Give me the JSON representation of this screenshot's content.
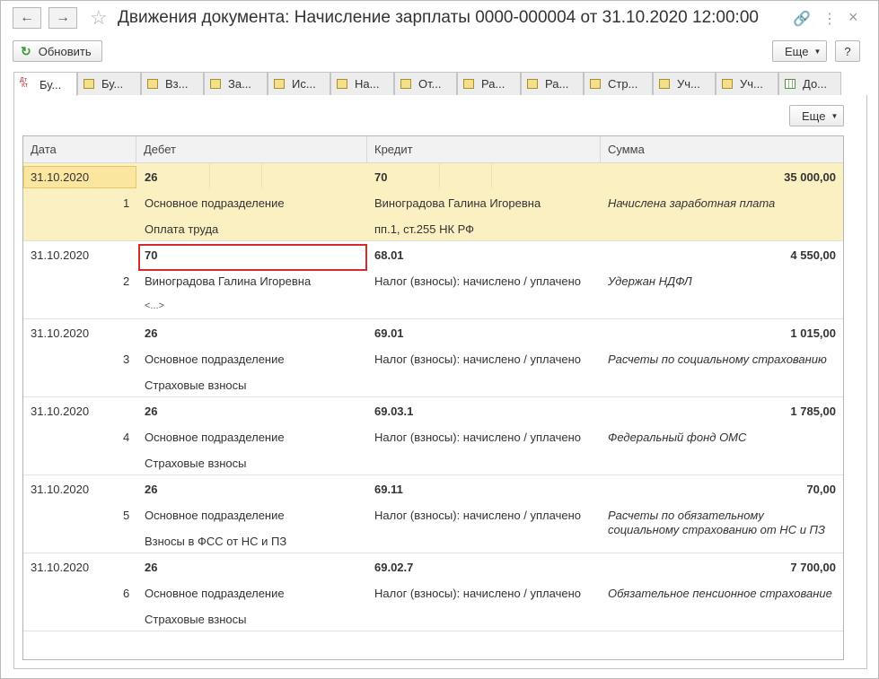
{
  "window": {
    "title": "Движения документа: Начисление зарплаты 0000-000004 от 31.10.2020 12:00:00",
    "back_icon": "←",
    "forward_icon": "→",
    "star_icon": "☆",
    "link_icon": "🔗",
    "more_icon": "⋮",
    "close_icon": "×"
  },
  "toolbar": {
    "refresh_label": "Обновить",
    "more_label": "Еще",
    "help_label": "?"
  },
  "tabs": [
    {
      "label": "Бу...",
      "icon": "dtkt-icon",
      "active": true
    },
    {
      "label": "Бу...",
      "icon": "register-icon"
    },
    {
      "label": "Вз...",
      "icon": "register-icon"
    },
    {
      "label": "За...",
      "icon": "register-icon"
    },
    {
      "label": "Ис...",
      "icon": "register-icon"
    },
    {
      "label": "На...",
      "icon": "register-icon"
    },
    {
      "label": "От...",
      "icon": "register-icon"
    },
    {
      "label": "Ра...",
      "icon": "register-icon"
    },
    {
      "label": "Ра...",
      "icon": "register-icon"
    },
    {
      "label": "Стр...",
      "icon": "register-icon"
    },
    {
      "label": "Уч...",
      "icon": "register-icon"
    },
    {
      "label": "Уч...",
      "icon": "register-icon"
    },
    {
      "label": "До...",
      "icon": "table-icon"
    }
  ],
  "panel": {
    "more_label": "Еще"
  },
  "table": {
    "columns": [
      "Дата",
      "Дебет",
      "Кредит",
      "Сумма"
    ],
    "rows": [
      {
        "date": "31.10.2020",
        "n": "1",
        "debit": "26",
        "debit_sub1": "Основное подразделение",
        "debit_sub2": "Оплата труда",
        "credit": "70",
        "credit_sub1": "Виноградова Галина Игоревна",
        "credit_sub2": "пп.1, ст.255 НК РФ",
        "amount": "35 000,00",
        "content": "Начислена заработная плата",
        "content2": ""
      },
      {
        "date": "31.10.2020",
        "n": "2",
        "debit": "70",
        "debit_sub1": "Виноградова Галина Игоревна",
        "debit_sub2": "<...>",
        "credit": "68.01",
        "credit_sub1": "Налог (взносы): начислено / уплачено",
        "credit_sub2": "",
        "amount": "4 550,00",
        "content": "Удержан НДФЛ",
        "content2": ""
      },
      {
        "date": "31.10.2020",
        "n": "3",
        "debit": "26",
        "debit_sub1": "Основное подразделение",
        "debit_sub2": "Страховые взносы",
        "credit": "69.01",
        "credit_sub1": "Налог (взносы): начислено / уплачено",
        "credit_sub2": "",
        "amount": "1 015,00",
        "content": "Расчеты по социальному страхованию",
        "content2": ""
      },
      {
        "date": "31.10.2020",
        "n": "4",
        "debit": "26",
        "debit_sub1": "Основное подразделение",
        "debit_sub2": "Страховые взносы",
        "credit": "69.03.1",
        "credit_sub1": "Налог (взносы): начислено / уплачено",
        "credit_sub2": "",
        "amount": "1 785,00",
        "content": "Федеральный фонд ОМС",
        "content2": ""
      },
      {
        "date": "31.10.2020",
        "n": "5",
        "debit": "26",
        "debit_sub1": "Основное подразделение",
        "debit_sub2": "Взносы в ФСС от НС и ПЗ",
        "credit": "69.11",
        "credit_sub1": "Налог (взносы): начислено / уплачено",
        "credit_sub2": "",
        "amount": "70,00",
        "content": "Расчеты по обязательному",
        "content2": "социальному страхованию от НС и ПЗ"
      },
      {
        "date": "31.10.2020",
        "n": "6",
        "debit": "26",
        "debit_sub1": "Основное подразделение",
        "debit_sub2": "Страховые взносы",
        "credit": "69.02.7",
        "credit_sub1": "Налог (взносы): начислено / уплачено",
        "credit_sub2": "",
        "amount": "7 700,00",
        "content": "Обязательное пенсионное страхование",
        "content2": ""
      }
    ]
  }
}
